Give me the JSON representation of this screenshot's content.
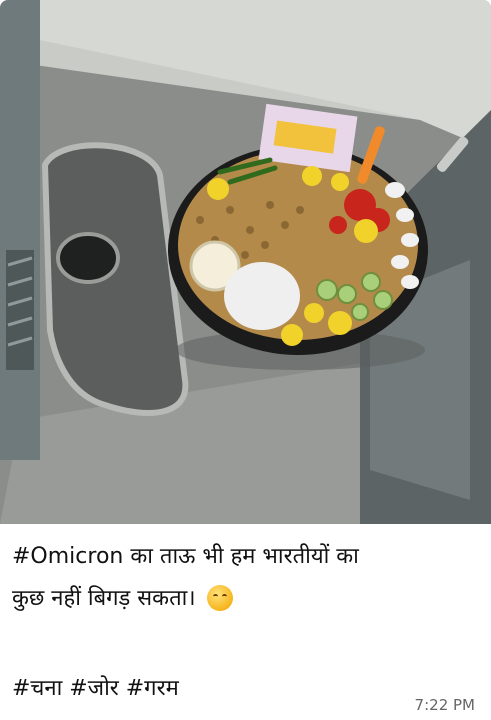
{
  "message": {
    "caption_line1": "#Omicron का ताऊ भी हम भारतीयों का",
    "caption_line2": "कुछ नहीं बिगड़ सकता।",
    "emoji_icon": "hugging-face-emoji",
    "hashtags": "#चना #जोर #गरम",
    "timestamp": "7:22 PM"
  },
  "colors": {
    "steel": "#8a8c8b",
    "bowl": "#1c1c1c",
    "chana": "#b48a4a",
    "lemon": "#f1d22a",
    "cucumber": "#a9cf7a",
    "tomato": "#c8251d"
  }
}
